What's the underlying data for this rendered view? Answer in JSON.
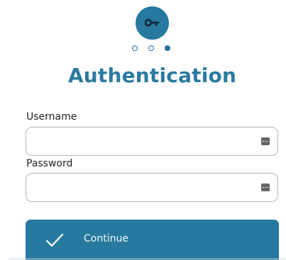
{
  "header": {
    "icon": "key-icon",
    "steps": [
      {
        "state": "incomplete"
      },
      {
        "state": "incomplete"
      },
      {
        "state": "current"
      }
    ],
    "title": "Authentication"
  },
  "form": {
    "username_label": "Username",
    "username_value": "",
    "password_label": "Password",
    "password_value": ""
  },
  "actions": {
    "continue_label": "Continue",
    "continue_icon": "checkmark-icon"
  },
  "colors": {
    "accent": "#27799f",
    "title": "#2b7aa0"
  }
}
